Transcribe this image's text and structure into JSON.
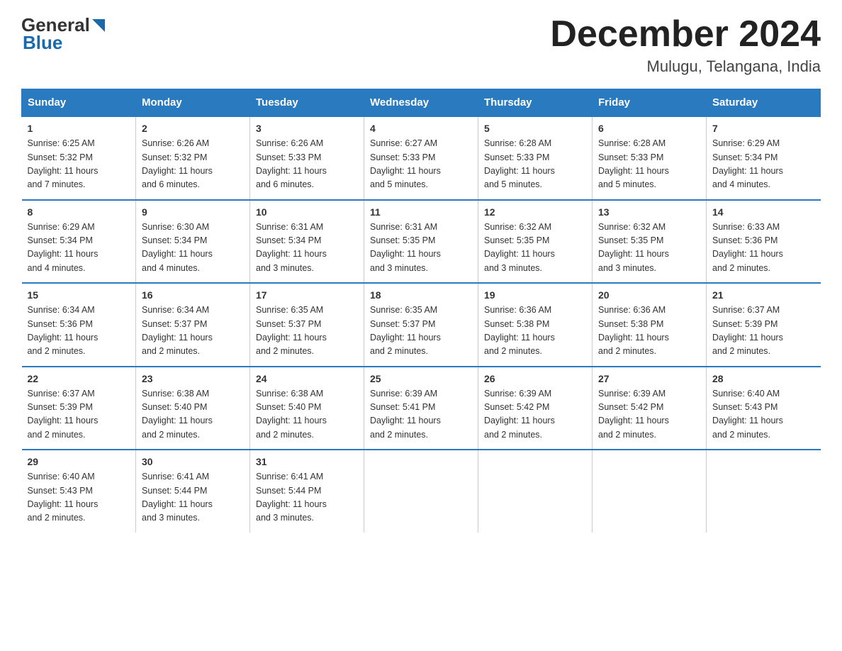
{
  "header": {
    "logo_general": "General",
    "logo_blue": "Blue",
    "month_title": "December 2024",
    "location": "Mulugu, Telangana, India"
  },
  "days_of_week": [
    "Sunday",
    "Monday",
    "Tuesday",
    "Wednesday",
    "Thursday",
    "Friday",
    "Saturday"
  ],
  "weeks": [
    [
      {
        "day": "1",
        "info": "Sunrise: 6:25 AM\nSunset: 5:32 PM\nDaylight: 11 hours\nand 7 minutes."
      },
      {
        "day": "2",
        "info": "Sunrise: 6:26 AM\nSunset: 5:32 PM\nDaylight: 11 hours\nand 6 minutes."
      },
      {
        "day": "3",
        "info": "Sunrise: 6:26 AM\nSunset: 5:33 PM\nDaylight: 11 hours\nand 6 minutes."
      },
      {
        "day": "4",
        "info": "Sunrise: 6:27 AM\nSunset: 5:33 PM\nDaylight: 11 hours\nand 5 minutes."
      },
      {
        "day": "5",
        "info": "Sunrise: 6:28 AM\nSunset: 5:33 PM\nDaylight: 11 hours\nand 5 minutes."
      },
      {
        "day": "6",
        "info": "Sunrise: 6:28 AM\nSunset: 5:33 PM\nDaylight: 11 hours\nand 5 minutes."
      },
      {
        "day": "7",
        "info": "Sunrise: 6:29 AM\nSunset: 5:34 PM\nDaylight: 11 hours\nand 4 minutes."
      }
    ],
    [
      {
        "day": "8",
        "info": "Sunrise: 6:29 AM\nSunset: 5:34 PM\nDaylight: 11 hours\nand 4 minutes."
      },
      {
        "day": "9",
        "info": "Sunrise: 6:30 AM\nSunset: 5:34 PM\nDaylight: 11 hours\nand 4 minutes."
      },
      {
        "day": "10",
        "info": "Sunrise: 6:31 AM\nSunset: 5:34 PM\nDaylight: 11 hours\nand 3 minutes."
      },
      {
        "day": "11",
        "info": "Sunrise: 6:31 AM\nSunset: 5:35 PM\nDaylight: 11 hours\nand 3 minutes."
      },
      {
        "day": "12",
        "info": "Sunrise: 6:32 AM\nSunset: 5:35 PM\nDaylight: 11 hours\nand 3 minutes."
      },
      {
        "day": "13",
        "info": "Sunrise: 6:32 AM\nSunset: 5:35 PM\nDaylight: 11 hours\nand 3 minutes."
      },
      {
        "day": "14",
        "info": "Sunrise: 6:33 AM\nSunset: 5:36 PM\nDaylight: 11 hours\nand 2 minutes."
      }
    ],
    [
      {
        "day": "15",
        "info": "Sunrise: 6:34 AM\nSunset: 5:36 PM\nDaylight: 11 hours\nand 2 minutes."
      },
      {
        "day": "16",
        "info": "Sunrise: 6:34 AM\nSunset: 5:37 PM\nDaylight: 11 hours\nand 2 minutes."
      },
      {
        "day": "17",
        "info": "Sunrise: 6:35 AM\nSunset: 5:37 PM\nDaylight: 11 hours\nand 2 minutes."
      },
      {
        "day": "18",
        "info": "Sunrise: 6:35 AM\nSunset: 5:37 PM\nDaylight: 11 hours\nand 2 minutes."
      },
      {
        "day": "19",
        "info": "Sunrise: 6:36 AM\nSunset: 5:38 PM\nDaylight: 11 hours\nand 2 minutes."
      },
      {
        "day": "20",
        "info": "Sunrise: 6:36 AM\nSunset: 5:38 PM\nDaylight: 11 hours\nand 2 minutes."
      },
      {
        "day": "21",
        "info": "Sunrise: 6:37 AM\nSunset: 5:39 PM\nDaylight: 11 hours\nand 2 minutes."
      }
    ],
    [
      {
        "day": "22",
        "info": "Sunrise: 6:37 AM\nSunset: 5:39 PM\nDaylight: 11 hours\nand 2 minutes."
      },
      {
        "day": "23",
        "info": "Sunrise: 6:38 AM\nSunset: 5:40 PM\nDaylight: 11 hours\nand 2 minutes."
      },
      {
        "day": "24",
        "info": "Sunrise: 6:38 AM\nSunset: 5:40 PM\nDaylight: 11 hours\nand 2 minutes."
      },
      {
        "day": "25",
        "info": "Sunrise: 6:39 AM\nSunset: 5:41 PM\nDaylight: 11 hours\nand 2 minutes."
      },
      {
        "day": "26",
        "info": "Sunrise: 6:39 AM\nSunset: 5:42 PM\nDaylight: 11 hours\nand 2 minutes."
      },
      {
        "day": "27",
        "info": "Sunrise: 6:39 AM\nSunset: 5:42 PM\nDaylight: 11 hours\nand 2 minutes."
      },
      {
        "day": "28",
        "info": "Sunrise: 6:40 AM\nSunset: 5:43 PM\nDaylight: 11 hours\nand 2 minutes."
      }
    ],
    [
      {
        "day": "29",
        "info": "Sunrise: 6:40 AM\nSunset: 5:43 PM\nDaylight: 11 hours\nand 2 minutes."
      },
      {
        "day": "30",
        "info": "Sunrise: 6:41 AM\nSunset: 5:44 PM\nDaylight: 11 hours\nand 3 minutes."
      },
      {
        "day": "31",
        "info": "Sunrise: 6:41 AM\nSunset: 5:44 PM\nDaylight: 11 hours\nand 3 minutes."
      },
      {
        "day": "",
        "info": ""
      },
      {
        "day": "",
        "info": ""
      },
      {
        "day": "",
        "info": ""
      },
      {
        "day": "",
        "info": ""
      }
    ]
  ]
}
